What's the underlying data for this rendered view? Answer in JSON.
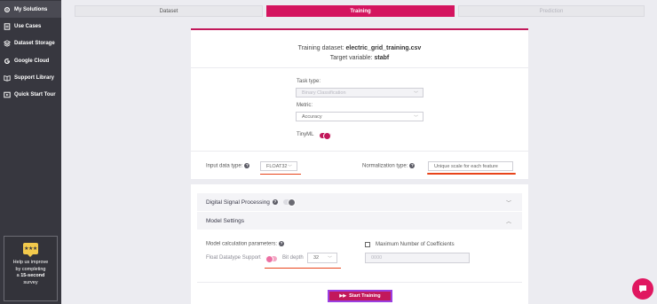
{
  "sidebar": {
    "items": [
      {
        "label": "My Solutions",
        "icon": "gear-icon"
      },
      {
        "label": "Use Cases",
        "icon": "document-icon"
      },
      {
        "label": "Dataset Storage",
        "icon": "layers-icon"
      },
      {
        "label": "Google Cloud",
        "icon": "google-icon"
      },
      {
        "label": "Support Library",
        "icon": "book-icon"
      },
      {
        "label": "Quick Start Tour",
        "icon": "tour-icon"
      }
    ],
    "survey": {
      "badge": "★★★",
      "line1": "Help us improve",
      "line2": "by completing",
      "line3_prefix": "a ",
      "line3_bold": "15-second",
      "line4": "survey"
    }
  },
  "steps": [
    "Dataset",
    "Training",
    "Prediction"
  ],
  "training": {
    "dataset_label": "Training dataset: ",
    "dataset_value": "electric_grid_training.csv",
    "target_label": "Target variable: ",
    "target_value": "stabf",
    "task_type_label": "Task type:",
    "task_type_value": "Binary Classification",
    "metric_label": "Metric:",
    "metric_value": "Accuracy",
    "tinyml_label": "TinyML",
    "input_type_label": "Input data type:",
    "input_type_value": "FLOAT32",
    "normalization_label": "Normalization type:",
    "normalization_value": "Unique scale for each feature"
  },
  "advanced": {
    "dsp_label": "Digital Signal Processing",
    "model_settings_label": "Model Settings",
    "calc_params_label": "Model calculation parameters:",
    "float_support_label": "Float Datatype Support",
    "bit_depth_label": "Bit depth",
    "bit_depth_value": "32",
    "max_coeff_label": "Maximum Number of Coefficients",
    "max_coeff_placeholder": "0000"
  },
  "actions": {
    "start_training": "Start Training"
  },
  "colors": {
    "accent": "#c2185b",
    "sidebar": "#37373f",
    "underline": "#e8441b"
  }
}
